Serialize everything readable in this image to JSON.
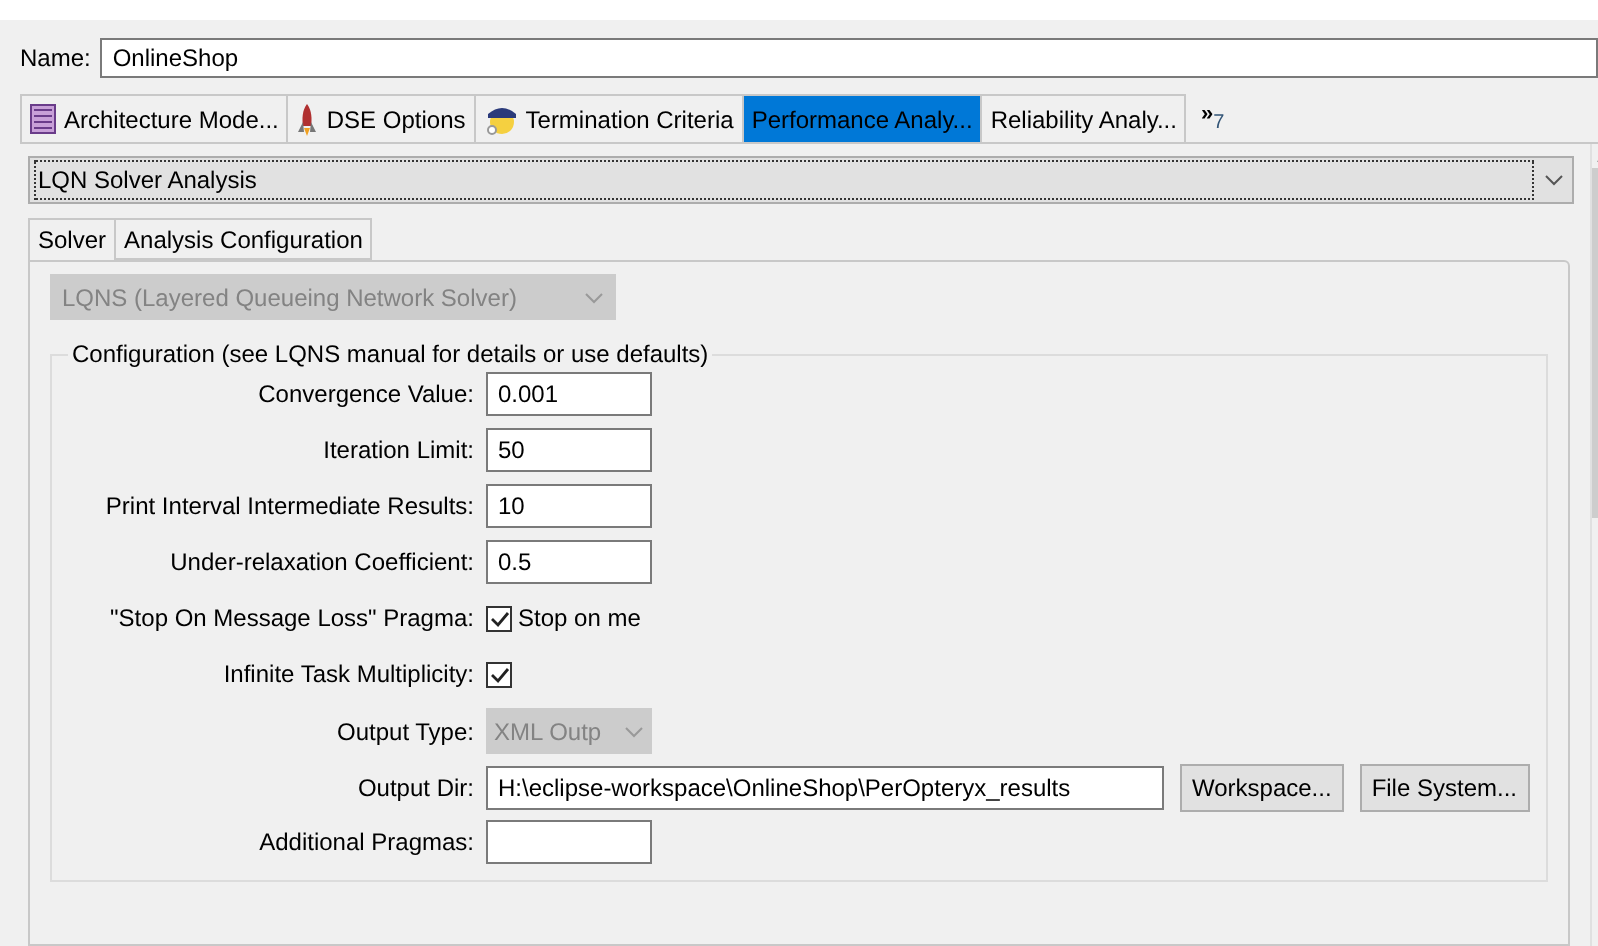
{
  "name_field": {
    "label": "Name:",
    "value": "OnlineShop"
  },
  "tabs": [
    {
      "label": "Architecture Mode...",
      "kind": "list",
      "selected": false
    },
    {
      "label": "DSE Options",
      "kind": "rocket",
      "selected": false
    },
    {
      "label": "Termination Criteria",
      "kind": "officer",
      "selected": false
    },
    {
      "label": "Performance Analy...",
      "kind": "plain",
      "selected": true
    },
    {
      "label": "Reliability Analy...",
      "kind": "plain",
      "selected": false
    }
  ],
  "tabs_overflow": {
    "chevron": "»",
    "count": "7"
  },
  "analysis_select": {
    "value": "LQN Solver Analysis"
  },
  "subtabs": [
    {
      "label": "Solver",
      "selected": true
    },
    {
      "label": "Analysis Configuration",
      "selected": false
    }
  ],
  "solver_select": {
    "value": "LQNS (Layered Queueing Network Solver)",
    "disabled": true
  },
  "configuration": {
    "title": "Configuration (see LQNS manual for details or use defaults)",
    "rows": [
      {
        "kind": "text",
        "label": "Convergence Value:",
        "value": "0.001"
      },
      {
        "kind": "text",
        "label": "Iteration Limit:",
        "value": "50"
      },
      {
        "kind": "text",
        "label": "Print Interval Intermediate Results:",
        "value": "10"
      },
      {
        "kind": "text",
        "label": "Under-relaxation Coefficient:",
        "value": "0.5"
      },
      {
        "kind": "checkbox",
        "label": "\"Stop On Message Loss\" Pragma:",
        "checked": true,
        "text": "Stop on me"
      },
      {
        "kind": "checkbox",
        "label": "Infinite Task Multiplicity:",
        "checked": true
      },
      {
        "kind": "select",
        "label": "Output Type:",
        "value": "XML Outp",
        "disabled": true
      },
      {
        "kind": "path",
        "label": "Output Dir:",
        "value": "H:\\eclipse-workspace\\OnlineShop\\PerOpteryx_results",
        "buttons": [
          "Workspace...",
          "File System..."
        ]
      },
      {
        "kind": "text",
        "label": "Additional Pragmas:"
      }
    ]
  }
}
